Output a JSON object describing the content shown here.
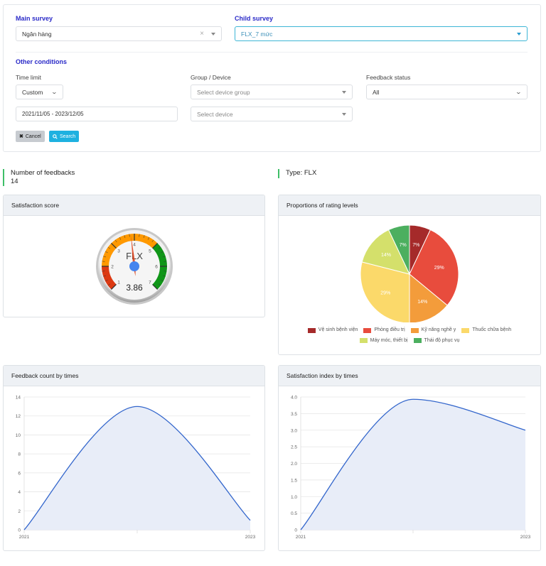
{
  "filters": {
    "main_survey": {
      "label": "Main survey",
      "value": "Ngân hàng"
    },
    "child_survey": {
      "label": "Child survey",
      "value": "FLX_7 mức"
    },
    "other_conditions_label": "Other conditions",
    "time_limit": {
      "label": "Time limit",
      "value": "Custom",
      "date_range": "2021/11/05 - 2023/12/05"
    },
    "group_device": {
      "label": "Group / Device",
      "group_placeholder": "Select device group",
      "device_placeholder": "Select device"
    },
    "feedback_status": {
      "label": "Feedback status",
      "value": "All"
    },
    "buttons": {
      "cancel": "Cancel",
      "search": "Search"
    }
  },
  "stats": {
    "feedback_count_label": "Number of feedbacks",
    "feedback_count_value": "14",
    "type_label": "Type: FLX"
  },
  "cards": {
    "satisfaction_score": "Satisfaction score",
    "proportions": "Proportions of rating levels",
    "feedback_count_by_times": "Feedback count by times",
    "satisfaction_index_by_times": "Satisfaction index by times"
  },
  "gauge": {
    "label": "FLX",
    "value": 3.86,
    "value_text": "3.86",
    "min": 1,
    "max": 7,
    "ticks": [
      "1",
      "2",
      "3",
      "4",
      "5",
      "6",
      "7"
    ],
    "bands": [
      {
        "from": 1,
        "to": 2,
        "color": "#dc3912"
      },
      {
        "from": 2,
        "to": 5,
        "color": "#ff9900"
      },
      {
        "from": 5,
        "to": 7,
        "color": "#109618"
      }
    ]
  },
  "chart_data": [
    {
      "type": "pie",
      "title": "Proportions of rating levels",
      "labels": [
        "Vệ sinh bệnh viện",
        "Phòng điều trị",
        "Kỹ năng nghề y",
        "Thuốc chữa bệnh",
        "Máy móc, thiết bị",
        "Thái độ phục vụ"
      ],
      "values": [
        7,
        29,
        14,
        29,
        14,
        7
      ],
      "data_labels": [
        "7%",
        "29%",
        "14%",
        "29%",
        "14%",
        "7%"
      ],
      "colors": [
        "#a52a2a",
        "#e84c3d",
        "#f39c3b",
        "#fbd96a",
        "#d4e06b",
        "#4caf5f"
      ],
      "legend": "bottom"
    },
    {
      "type": "area",
      "title": "Feedback count by times",
      "x": [
        "2021",
        "2022",
        "2023"
      ],
      "x_tick_labels": [
        "2021",
        "",
        "2023"
      ],
      "values": [
        0,
        13,
        1
      ],
      "yticks": [
        0,
        2,
        4,
        6,
        8,
        10,
        12,
        14
      ],
      "ylim": [
        0,
        14
      ],
      "grid": true,
      "line_color": "#3366cc",
      "fill_color": "#e8edf8"
    },
    {
      "type": "area",
      "title": "Satisfaction index by times",
      "x": [
        "2021",
        "2022",
        "2023"
      ],
      "x_tick_labels": [
        "2021",
        "",
        "2023"
      ],
      "values": [
        0,
        3.93,
        3.0
      ],
      "yticks": [
        0,
        0.5,
        1.0,
        1.5,
        2.0,
        2.5,
        3.0,
        3.5,
        4.0
      ],
      "ytick_labels": [
        "0",
        "0.5",
        "1.0",
        "1.5",
        "2.0",
        "2.5",
        "3.0",
        "3.5",
        "4.0"
      ],
      "ylim": [
        0,
        4.0
      ],
      "grid": true,
      "line_color": "#3366cc",
      "fill_color": "#e8edf8"
    }
  ]
}
